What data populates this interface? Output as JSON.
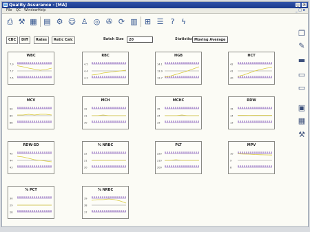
{
  "window": {
    "title": "Quality Assurance - [MA]",
    "minimize": "_",
    "close": "x"
  },
  "menu": {
    "items": [
      "File",
      "QC",
      "Window",
      "Help"
    ],
    "doc_controls": "_ □ x"
  },
  "toolbar": {
    "icons": [
      "printer-icon",
      "wrench-icon",
      "table-icon",
      "chart-icon",
      "tools-icon",
      "users-icon",
      "person-icon",
      "target-icon",
      "gear-icon",
      "cycle-icon",
      "bar-chart-icon",
      "grid-icon",
      "list-icon",
      "help-icon",
      "lightning-icon"
    ]
  },
  "tabs": [
    "CBC",
    "Diff",
    "Rates",
    "Retic Calc"
  ],
  "batch": {
    "label": "Batch Size",
    "value": "20"
  },
  "statistics": {
    "label": "Statistics",
    "value": "Moving Average"
  },
  "sidebar": {
    "icons": [
      "book-icon",
      "pen-icon",
      "folder-icon",
      "card-icon",
      "card-icon",
      "display-icon",
      "grid-icon",
      "tool-icon"
    ]
  },
  "colors": {
    "trend_line": "#d9c93a",
    "limit_line": "#7a4fb3",
    "grid_line": "#8a8a84"
  },
  "chart_data": [
    {
      "type": "line",
      "title": "WBC",
      "yticks": [
        "7.9",
        "7.7",
        "7.5"
      ],
      "series": [
        {
          "values": [
            7.85,
            7.82,
            7.78,
            7.75,
            7.72,
            7.74,
            7.78
          ]
        }
      ]
    },
    {
      "type": "line",
      "title": "RBC",
      "yticks": [
        "4.5",
        "4.4",
        "4.3"
      ],
      "series": [
        {
          "values": [
            4.34,
            4.35,
            4.37,
            4.38,
            4.39,
            4.4,
            4.41
          ]
        }
      ]
    },
    {
      "type": "line",
      "title": "HGB",
      "yticks": [
        "14.1",
        "13.9",
        "13.7"
      ],
      "series": [
        {
          "values": [
            13.72,
            13.75,
            13.8,
            13.85,
            13.9,
            13.96,
            14.02
          ]
        }
      ]
    },
    {
      "type": "line",
      "title": "HCT",
      "yticks": [
        "42",
        "41",
        "40"
      ],
      "series": [
        {
          "values": [
            40.2,
            40.4,
            40.7,
            41.0,
            41.2,
            41.4,
            41.5
          ]
        }
      ]
    },
    {
      "type": "line",
      "title": "MCV",
      "yticks": [
        "90",
        "89",
        "88"
      ],
      "series": [
        {
          "values": [
            89.1,
            89.1,
            89.2,
            89.1,
            89.2,
            89.2,
            89.1
          ]
        }
      ]
    },
    {
      "type": "line",
      "title": "MCH",
      "yticks": [
        "32",
        "31",
        "30"
      ],
      "series": [
        {
          "values": [
            31.0,
            31.0,
            31.1,
            31.0,
            31.0,
            31.0,
            31.0
          ]
        }
      ]
    },
    {
      "type": "line",
      "title": "MCHC",
      "yticks": [
        "35",
        "34",
        "33"
      ],
      "series": [
        {
          "values": [
            34.0,
            34.0,
            34.0,
            34.1,
            34.0,
            34.0,
            34.0
          ]
        }
      ]
    },
    {
      "type": "line",
      "title": "RDW",
      "yticks": [
        "15",
        "14",
        "13"
      ],
      "series": [
        {
          "values": [
            14.05,
            14.05,
            14.04,
            14.05,
            14.05,
            14.05,
            14.05
          ]
        }
      ]
    },
    {
      "type": "line",
      "title": "RDW-SD",
      "yticks": [
        "45",
        "44",
        "43"
      ],
      "series": [
        {
          "values": [
            44.6,
            44.5,
            44.3,
            44.1,
            44.0,
            43.9,
            43.8
          ]
        }
      ]
    },
    {
      "type": "line",
      "title": "% NRBC",
      "yticks": [
        "22",
        "21",
        "20"
      ],
      "series": [
        {
          "values": [
            21.0,
            21.0,
            21.0,
            21.0,
            21.0,
            21.0,
            21.0
          ]
        }
      ]
    },
    {
      "type": "line",
      "title": "PLT",
      "yticks": [
        "220",
        "210",
        "200"
      ],
      "series": [
        {
          "values": [
            210,
            210,
            211,
            210,
            210,
            210,
            210
          ]
        }
      ]
    },
    {
      "type": "line",
      "title": "MPV",
      "yticks": [
        "10",
        "9",
        "8"
      ],
      "series": [
        {
          "values": [
            9.95,
            9.92,
            9.9,
            9.85,
            9.82,
            9.8,
            9.78
          ]
        }
      ]
    },
    {
      "type": "line",
      "title": "% PCT",
      "yticks": [
        "30",
        "29",
        "28"
      ],
      "series": [
        {
          "values": [
            29.0,
            29.0,
            29.0,
            29.0,
            29.0,
            29.0,
            29.0
          ]
        }
      ]
    },
    {
      "type": "line",
      "title": "% NRBC",
      "yticks": [
        "39",
        "38",
        "37"
      ],
      "series": [
        {
          "values": [
            38.7,
            38.8,
            38.8,
            38.9,
            38.8,
            38.6,
            38.3
          ]
        }
      ]
    }
  ]
}
